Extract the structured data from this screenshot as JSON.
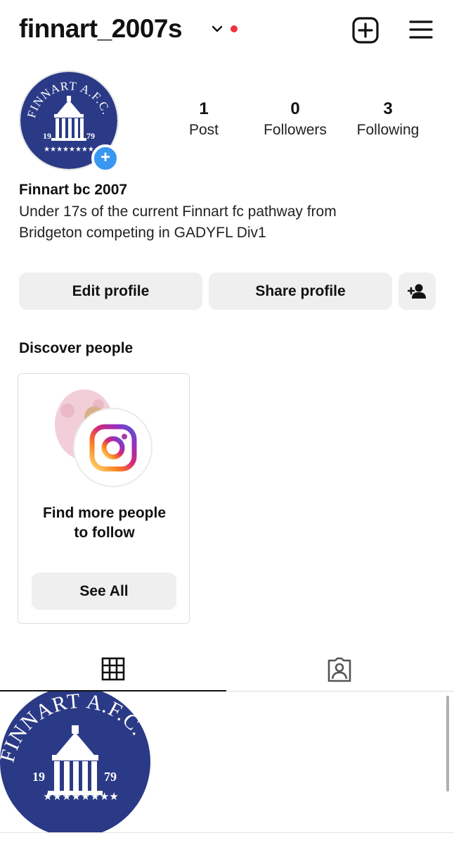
{
  "header": {
    "username": "finnart_2007s",
    "chevron_icon": "chevron-down-icon",
    "notification_color": "#ef3340",
    "add_icon": "plus-square-icon",
    "menu_icon": "hamburger-menu-icon"
  },
  "profile": {
    "avatar_text": {
      "name": "FINNART A.F.C.",
      "year_left": "19",
      "year_right": "79",
      "stars": "★★★★★★★★"
    },
    "add_story_icon": "plus-circle-icon",
    "add_story_color": "#3897f0",
    "stats": [
      {
        "value": "1",
        "label": "Post"
      },
      {
        "value": "0",
        "label": "Followers"
      },
      {
        "value": "3",
        "label": "Following"
      }
    ],
    "display_name": "Finnart bc 2007",
    "bio_line1": "Under 17s of the current Finnart fc pathway from",
    "bio_line2": "Bridgeton competing in GADYFL Div1"
  },
  "actions": {
    "edit_label": "Edit profile",
    "share_label": "Share profile",
    "add_user_icon": "add-person-icon"
  },
  "discover": {
    "title": "Discover people",
    "card_line1": "Find more people",
    "card_line2": "to follow",
    "see_all_label": "See All",
    "ig_icon": "instagram-logo-icon"
  },
  "tabs": {
    "grid_icon": "grid-icon",
    "tagged_icon": "tagged-person-icon"
  },
  "post": {
    "thumb_text": {
      "name": "FINNART A.F.C.",
      "year_left": "19",
      "year_right": "79",
      "stars": "★★★★★★★★"
    }
  },
  "colors": {
    "club_navy": "#2b3a86",
    "button_bg": "#efefef"
  }
}
